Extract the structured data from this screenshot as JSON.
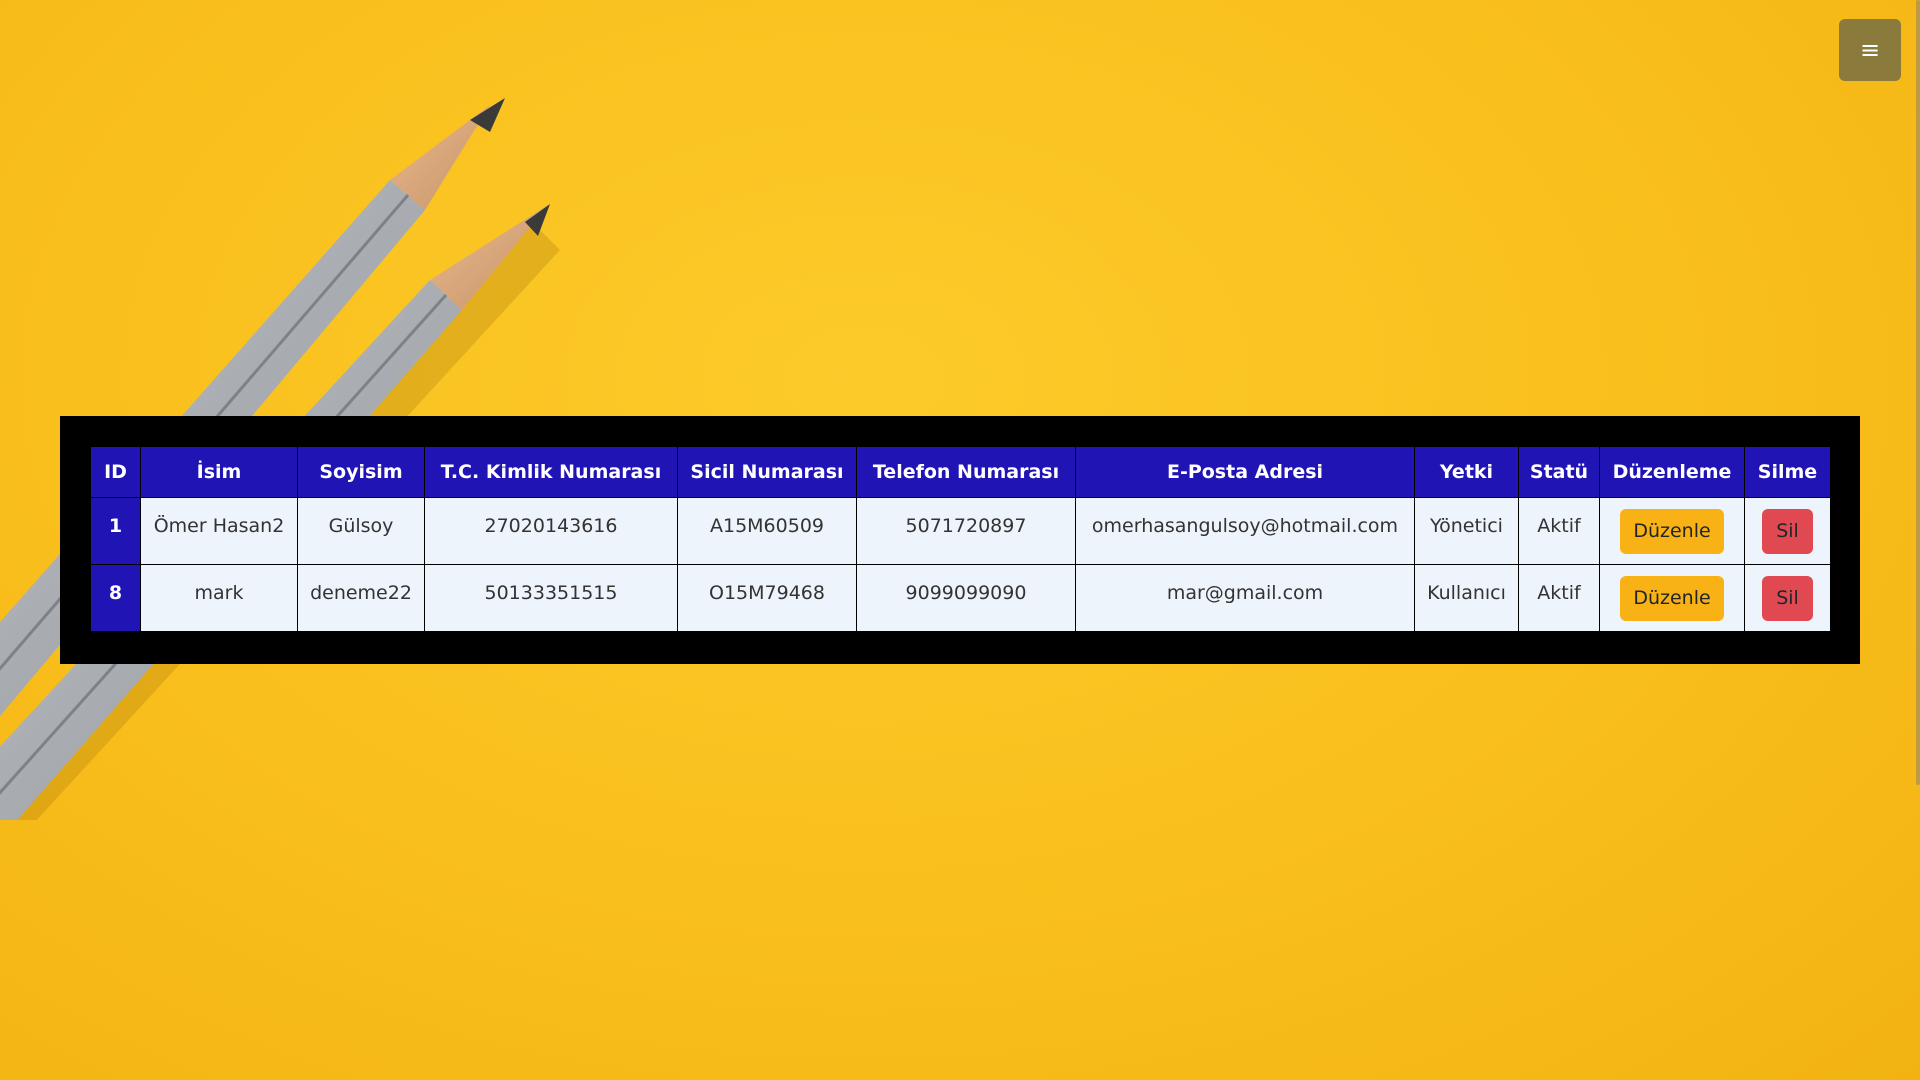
{
  "menu": {
    "icon": "hamburger-icon",
    "glyph": "≡"
  },
  "colors": {
    "background": "#f9bf1c",
    "header": "#2114b5",
    "panel": "#000000",
    "row": "#eef4fb",
    "edit_button": "#f9b215",
    "delete_button": "#e04952",
    "menu_button": "#8a7a3c"
  },
  "table": {
    "headers": [
      "ID",
      "İsim",
      "Soyisim",
      "T.C. Kimlik Numarası",
      "Sicil Numarası",
      "Telefon Numarası",
      "E-Posta Adresi",
      "Yetki",
      "Statü",
      "Düzenleme",
      "Silme"
    ],
    "rows": [
      {
        "id": "1",
        "name": "Ömer Hasan2",
        "surname": "Gülsoy",
        "tc": "27020143616",
        "registry": "A15M60509",
        "phone": "5071720897",
        "email": "omerhasangulsoy@hotmail.com",
        "role": "Yönetici",
        "status": "Aktif",
        "edit_label": "Düzenle",
        "delete_label": "Sil"
      },
      {
        "id": "8",
        "name": "mark",
        "surname": "deneme22",
        "tc": "50133351515",
        "registry": "O15M79468",
        "phone": "9099099090",
        "email": "mar@gmail.com",
        "role": "Kullanıcı",
        "status": "Aktif",
        "edit_label": "Düzenle",
        "delete_label": "Sil"
      }
    ]
  }
}
